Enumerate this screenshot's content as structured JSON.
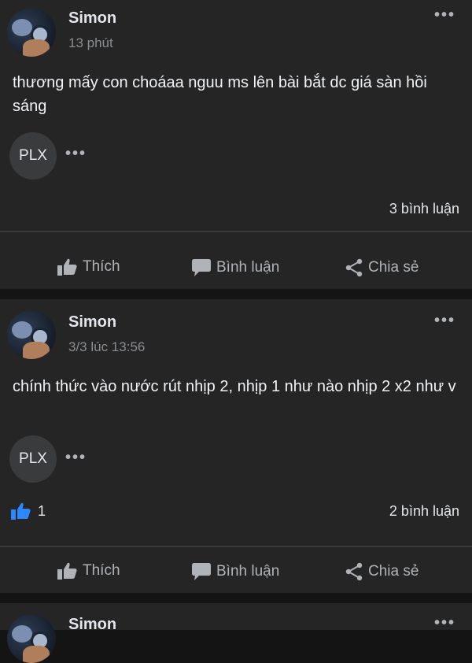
{
  "posts": [
    {
      "author": "Simon",
      "time": "13 phút",
      "text": "thương mấy con choáaa nguu ms lên bài bắt dc giá sàn hồi sáng",
      "chip": "PLX",
      "likes": "",
      "comments": "3 bình luận"
    },
    {
      "author": "Simon",
      "time": "3/3 lúc 13:56",
      "text": "chính thức vào nước rút nhịp 2, nhịp 1 như nào nhịp 2 x2 như v",
      "chip": "PLX",
      "likes": "1",
      "comments": "2 bình luận"
    },
    {
      "author": "Simon"
    }
  ],
  "actions": {
    "like": "Thích",
    "comment": "Bình luận",
    "share": "Chia sẻ"
  },
  "icons": {
    "more": "more-options-icon",
    "like": "thumbs-up-icon",
    "comment": "comment-bubble-icon",
    "share": "share-icon"
  },
  "colors": {
    "background": "#141414",
    "card": "#252525",
    "like_accent": "#2d88ff"
  }
}
